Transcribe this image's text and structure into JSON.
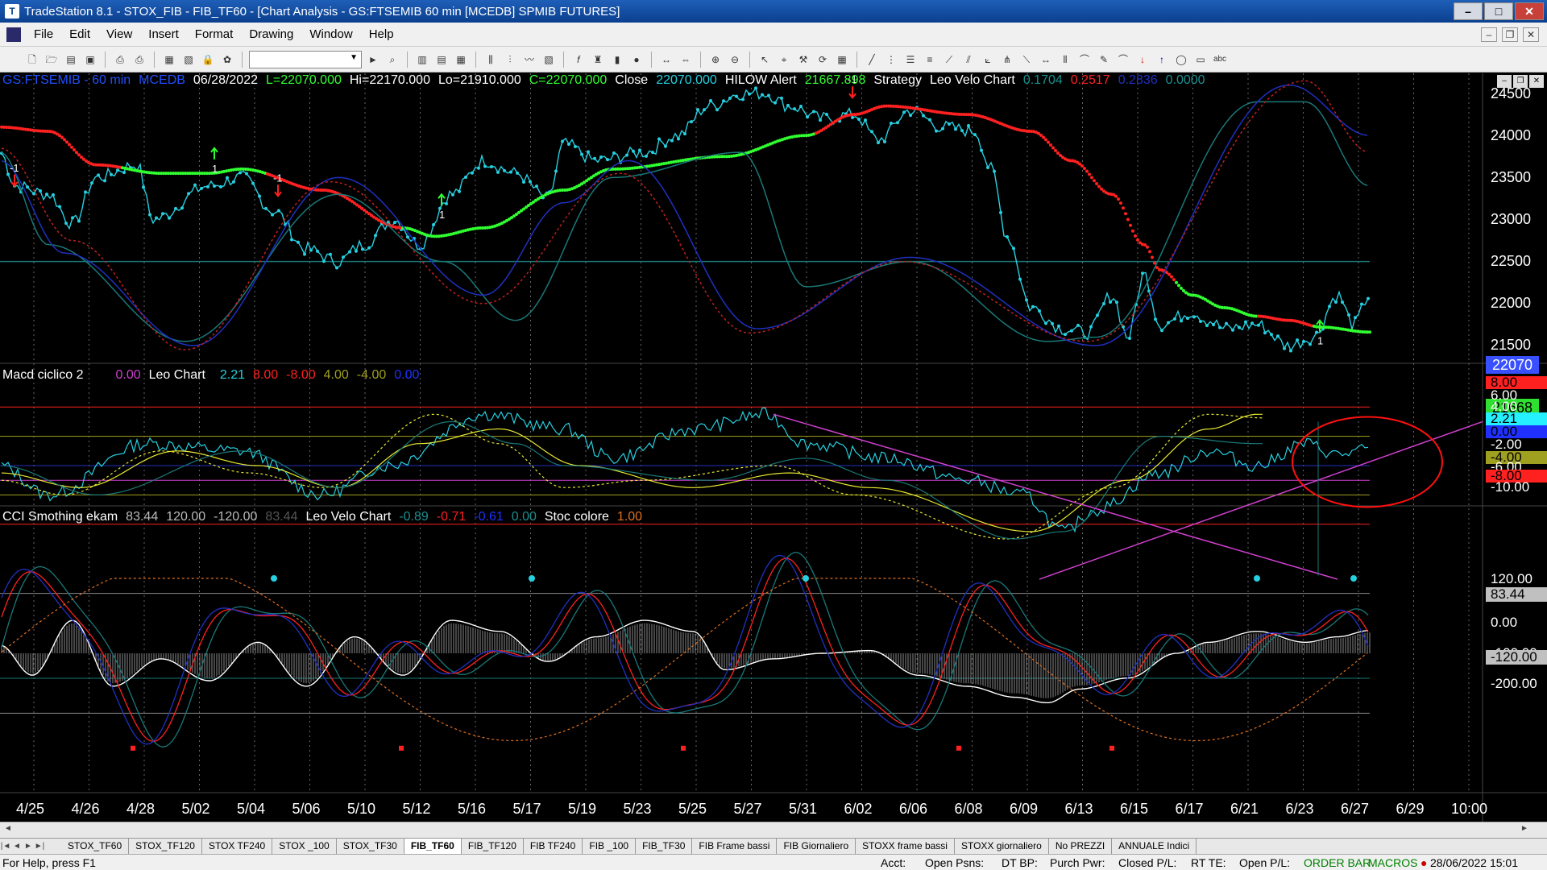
{
  "window": {
    "title": "TradeStation 8.1 - STOX_FIB - FIB_TF60 - [Chart Analysis - GS:FTSEMIB  60 min  [MCEDB] SPMIB FUTURES]"
  },
  "menu": [
    "File",
    "Edit",
    "View",
    "Insert",
    "Format",
    "Drawing",
    "Window",
    "Help"
  ],
  "price_panel": {
    "symbol": "GS:FTSEMIB - 60 min",
    "feed": "MCEDB",
    "date": "06/28/2022",
    "ohlc": [
      "L=22070.000",
      "Hi=22170.000",
      "Lo=21910.000",
      "C=22070.000"
    ],
    "close_label": "Close",
    "close_value": "22070.000",
    "alert_label": "HILOW Alert",
    "alert_value": "21667.898",
    "strategy_label": "Strategy",
    "leo_label": "Leo Velo Chart",
    "leo_values": [
      "0.1704",
      "0.2517",
      "0.2836",
      "0.0000"
    ],
    "price_axis": [
      "24500",
      "24000",
      "23500",
      "23000",
      "22500",
      "22000",
      "21500"
    ],
    "last_price": "22070",
    "alert_price": "21668",
    "signal_labels": [
      "-1",
      "1",
      "-1",
      "1",
      "-1",
      "1"
    ]
  },
  "macd_panel": {
    "name": "Macd ciclico 2",
    "v0": "0.00",
    "leo_label": "Leo Chart",
    "values": [
      "2.21",
      "8.00",
      "-8.00",
      "4.00",
      "-4.00",
      "0.00"
    ],
    "axis": [
      "8.00",
      "6.00",
      "4.00",
      "2.21",
      "0.00",
      "-2.00",
      "-4.00",
      "-6.00",
      "-8.00",
      "-10.00"
    ]
  },
  "cci_panel": {
    "name": "CCI Smothing ekam",
    "values": [
      "83.44",
      "120.00",
      "-120.00",
      "83.44"
    ],
    "leo_label": "Leo Velo Chart",
    "leo_values": [
      "-0.89",
      "-0.71",
      "-0.61",
      "0.00"
    ],
    "stoc_label": "Stoc colore",
    "stoc_value": "1.00",
    "axis": [
      "120.00",
      "83.44",
      "0.00",
      "-100.00",
      "-120.00",
      "-200.00"
    ]
  },
  "x_axis": [
    "4/25",
    "4/26",
    "4/28",
    "5/02",
    "5/04",
    "5/06",
    "5/10",
    "5/12",
    "5/16",
    "5/17",
    "5/19",
    "5/23",
    "5/25",
    "5/27",
    "5/31",
    "6/02",
    "6/06",
    "6/08",
    "6/09",
    "6/13",
    "6/15",
    "6/17",
    "6/21",
    "6/23",
    "6/27",
    "6/29",
    "10:00"
  ],
  "tabs": [
    "STOX_TF60",
    "STOX_TF120",
    "STOX TF240",
    "STOX _100",
    "STOX_TF30",
    "FIB_TF60",
    "FIB_TF120",
    "FIB TF240",
    "FIB _100",
    "FIB_TF30",
    "FIB Frame bassi",
    "FIB Giornaliero",
    "STOXX frame bassi",
    "STOXX giornaliero",
    "No PREZZI",
    "ANNUALE Indici"
  ],
  "active_tab": "FIB_TF60",
  "status": {
    "help": "For Help, press F1",
    "acct": "Acct:",
    "open_psns": "Open Psns:",
    "dt_bp": "DT BP:",
    "purch_pwr": "Purch Pwr:",
    "closed_pl": "Closed P/L:",
    "rt_te": "RT TE:",
    "open_pl": "Open P/L:",
    "order_bar": "ORDER BAR",
    "macros": "MACROS",
    "datetime": "28/06/2022 15:01"
  },
  "colors": {
    "cyan": "#25d0e0",
    "red": "#ff2020",
    "green": "#30ff30",
    "yellow": "#e8e830",
    "magenta": "#d040d0",
    "navy": "#2030c0",
    "teal": "#1a7878"
  }
}
